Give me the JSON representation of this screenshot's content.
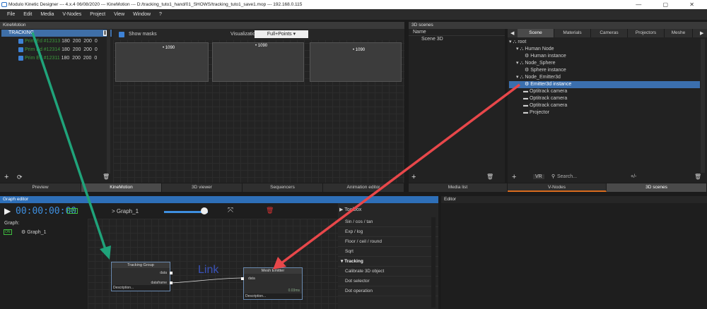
{
  "title": "Modulo Kinetic Designer --- 4.x.4 06/08/2020 --- KineMotion --- D:/tracking_tuto1_hand/01_SHOWS/tracking_tuto1_save1.mop --- 192.168.0.115",
  "window_controls": "—  ▢  ✕",
  "menu": [
    "File",
    "Edit",
    "Media",
    "V-Nodes",
    "Project",
    "View",
    "Window",
    "?"
  ],
  "kinemotion": {
    "header": "KineMotion",
    "group": "TRACKING",
    "rows": [
      {
        "name": "Prim Ed #12313",
        "v": [
          "180",
          "200",
          "200",
          "0"
        ]
      },
      {
        "name": "Prim Ed #12314",
        "v": [
          "180",
          "200",
          "200",
          "0"
        ]
      },
      {
        "name": "Prim Ed #12311",
        "v": [
          "180",
          "200",
          "200",
          "0"
        ]
      }
    ],
    "show_masks": "Show masks",
    "visualization_label": "Visualization:",
    "visualization_value": "Full+Points",
    "points": [
      "1090",
      "1090",
      "1090"
    ]
  },
  "bottom_tabs": [
    "Preview",
    "KineMotion",
    "3D viewer",
    "Sequencers",
    "Animation editor"
  ],
  "scenes": {
    "header": "3D scenes",
    "col_name": "Name",
    "scene_item": "Scene 3D",
    "tabs": [
      "Scene",
      "Materials",
      "Cameras",
      "Projectors",
      "Meshe"
    ],
    "tree": [
      "root",
      "Human Node",
      "Human instance",
      "Node_Sphere",
      "Sphere instance",
      "Node_Emitter3d",
      "Emitter3d instance",
      "Optitrack camera",
      "Optitrack camera",
      "Optitrack camera",
      "Projector"
    ],
    "vr": "VR",
    "search": "Search...",
    "plusminus": "+/-",
    "bottom_tabs": [
      "Media list",
      "V-Nodes",
      "3D scenes"
    ]
  },
  "graph": {
    "header": "Graph editor",
    "timecode": "00:00:00:00",
    "on": "ON",
    "breadcrumb": "> Graph_1",
    "graph_label": "Graph:",
    "graph_item": "Graph_1",
    "toolbox": "Toolbox",
    "link": "Link",
    "node1": {
      "title": "Tracking Group",
      "p1": "data",
      "p2": "dataframe",
      "desc": "Description..."
    },
    "node2": {
      "title": "Mesh Emitter",
      "p1": "data",
      "stat": "0.03ms",
      "desc": "Description..."
    },
    "toolbox_items": [
      "Sin / cos / tan",
      "Exp / log",
      "Floor / ceil / round",
      "Sqrt"
    ],
    "toolbox_section": "Tracking",
    "toolbox_items2": [
      "Calibrate 3D object",
      "Dot selector",
      "Dot operation"
    ]
  },
  "editor": {
    "header": "Editor"
  },
  "colors": {
    "accent": "#2e6fb8",
    "green_arrow": "#1fa37a",
    "red_arrow": "#e8474a"
  }
}
